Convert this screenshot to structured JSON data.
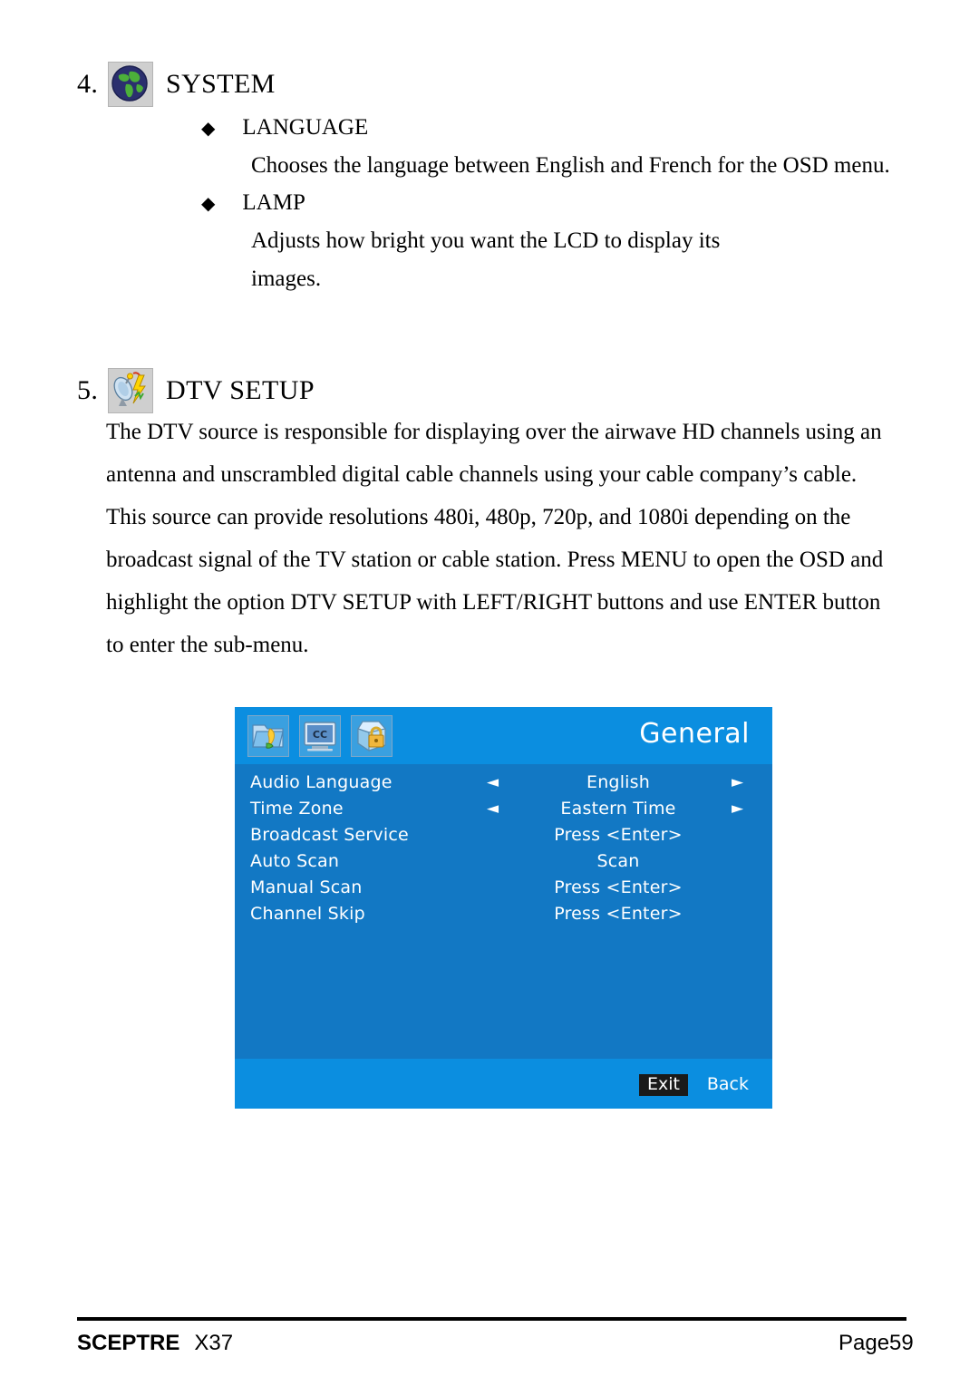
{
  "colors": {
    "osd_header_blue": "#0b8ee0",
    "osd_body_blue": "#1278c4",
    "osd_exit_bg": "#1a1a1a",
    "icon_plate_gray": "#cfcfcf",
    "globe_land": "#4caf3a",
    "globe_ocean": "#2b2f6e",
    "lightning_yellow": "#ffd400",
    "padlock_gold": "#e8a628"
  },
  "sections": [
    {
      "number": "4.",
      "title": "SYSTEM",
      "icon": "globe-icon",
      "bullets": [
        {
          "label": "LANGUAGE",
          "lines": [
            "Chooses the language between English and French for the OSD menu."
          ]
        },
        {
          "label": "LAMP",
          "lines": [
            "Adjusts how bright you want the LCD to display its",
            "images."
          ]
        }
      ]
    },
    {
      "number": "5.",
      "title": "DTV SETUP",
      "icon": "satellite-dish-lightning-icon",
      "paragraph": [
        "The DTV source is responsible for displaying over the airwave HD channels using an",
        "antenna and unscrambled digital cable channels using your cable company’s cable.",
        "This source can provide resolutions 480i, 480p, 720p, and 1080i depending on the",
        "broadcast signal of the TV station or cable station. Press MENU to open the OSD and",
        "highlight the option DTV SETUP with LEFT/RIGHT buttons and use ENTER button",
        "to enter the sub-menu."
      ]
    }
  ],
  "osd": {
    "title": "General",
    "icons": [
      {
        "name": "folder-pen-icon",
        "label": "Setup"
      },
      {
        "name": "closed-caption-icon",
        "label": "CC"
      },
      {
        "name": "parental-lock-icon",
        "label": "Lock"
      }
    ],
    "arrow_left": "◄",
    "arrow_right": "►",
    "rows": [
      {
        "label": "Audio Language",
        "value": "English",
        "arrows": true
      },
      {
        "label": "Time Zone",
        "value": "Eastern Time",
        "arrows": true
      },
      {
        "label": "Broadcast Service",
        "value": "Press <Enter>",
        "arrows": false
      },
      {
        "label": "Auto Scan",
        "value": "Scan",
        "arrows": false
      },
      {
        "label": "Manual Scan",
        "value": "Press <Enter>",
        "arrows": false
      },
      {
        "label": "Channel Skip",
        "value": "Press <Enter>",
        "arrows": false
      }
    ],
    "footer": {
      "exit": "Exit",
      "back": "Back"
    }
  },
  "page_footer": {
    "brand": "SCEPTRE",
    "model": "X37",
    "page": "Page59"
  }
}
